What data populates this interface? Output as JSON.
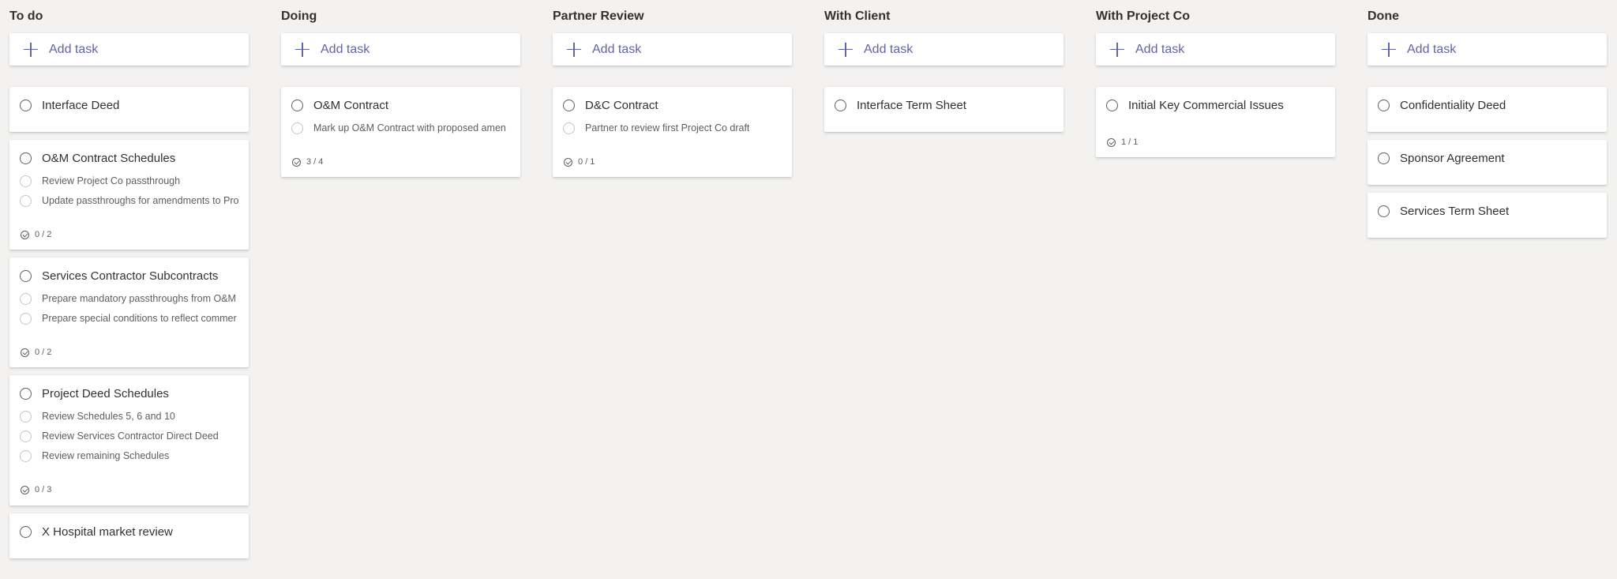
{
  "colors": {
    "accent": "#6264a7",
    "background": "#f3f2f1",
    "card": "#ffffff"
  },
  "add_task_label": "Add task",
  "columns": [
    {
      "title": "To do",
      "cards": [
        {
          "title": "Interface Deed"
        },
        {
          "title": "O&M Contract Schedules",
          "subtasks": [
            "Review Project Co passthrough",
            "Update passthroughs for amendments to Pro"
          ],
          "progress": "0 / 2"
        },
        {
          "title": "Services Contractor Subcontracts",
          "subtasks": [
            "Prepare mandatory passthroughs from O&M",
            "Prepare special conditions to reflect commer"
          ],
          "progress": "0 / 2"
        },
        {
          "title": "Project Deed Schedules",
          "subtasks": [
            "Review Schedules 5, 6 and 10",
            "Review Services Contractor Direct Deed",
            "Review remaining Schedules"
          ],
          "progress": "0 / 3"
        },
        {
          "title": "X Hospital market review"
        }
      ]
    },
    {
      "title": "Doing",
      "cards": [
        {
          "title": "O&M Contract",
          "subtasks": [
            "Mark up O&M Contract with proposed amen"
          ],
          "progress": "3 / 4"
        }
      ]
    },
    {
      "title": "Partner Review",
      "cards": [
        {
          "title": "D&C Contract",
          "subtasks": [
            "Partner to review first Project Co draft"
          ],
          "progress": "0 / 1"
        }
      ]
    },
    {
      "title": "With Client",
      "cards": [
        {
          "title": "Interface Term Sheet"
        }
      ]
    },
    {
      "title": "With Project Co",
      "cards": [
        {
          "title": "Initial Key Commercial Issues",
          "progress": "1 / 1"
        }
      ]
    },
    {
      "title": "Done",
      "cards": [
        {
          "title": "Confidentiality Deed"
        },
        {
          "title": "Sponsor Agreement"
        },
        {
          "title": "Services Term Sheet"
        }
      ]
    }
  ]
}
